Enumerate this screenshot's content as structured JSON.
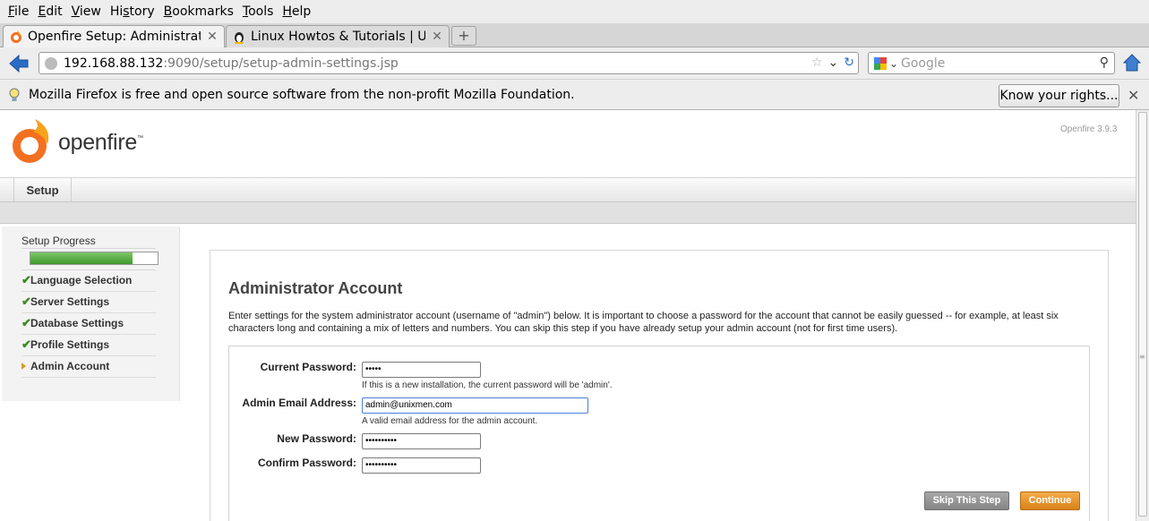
{
  "menubar": {
    "items": [
      {
        "accel": "F",
        "rest": "ile"
      },
      {
        "accel": "E",
        "rest": "dit"
      },
      {
        "accel": "V",
        "rest": "iew"
      },
      {
        "accel": "",
        "pre": "Hi",
        "accel2": "s",
        "rest": "tory"
      },
      {
        "accel": "B",
        "rest": "ookmarks"
      },
      {
        "accel": "T",
        "rest": "ools"
      },
      {
        "accel": "H",
        "rest": "elp"
      }
    ]
  },
  "tabs": [
    {
      "title": "Openfire Setup: Administrat...",
      "active": true
    },
    {
      "title": "Linux Howtos & Tutorials | U...",
      "active": false
    }
  ],
  "navbar": {
    "url_host": "192.168.88.132",
    "url_rest": ":9090/setup/setup-admin-settings.jsp",
    "search_placeholder": "Google"
  },
  "notification": {
    "message": "Mozilla Firefox is free and open source software from the non-profit Mozilla Foundation.",
    "button_label": "Know your rights..."
  },
  "page": {
    "logo_text": "openfire",
    "logo_tm": "™",
    "version": "Openfire 3.9.3",
    "nav_tab": "Setup",
    "sidebar": {
      "progress_label": "Setup Progress",
      "progress_fraction": 0.8,
      "steps": [
        {
          "label": "Language Selection",
          "done": true
        },
        {
          "label": "Server Settings",
          "done": true
        },
        {
          "label": "Database Settings",
          "done": true
        },
        {
          "label": "Profile Settings",
          "done": true
        },
        {
          "label": "Admin Account",
          "done": false
        }
      ]
    },
    "title": "Administrator Account",
    "intro": "Enter settings for the system administrator account (username of \"admin\") below. It is important to choose a password for the account that cannot be easily guessed -- for example, at least six characters long and containing a mix of letters and numbers. You can skip this step if you have already setup your admin account (not for first time users).",
    "form": {
      "current_password_label": "Current Password:",
      "current_password_value": "•••••",
      "current_password_hint": "If this is a new installation, the current password will be 'admin'.",
      "email_label": "Admin Email Address:",
      "email_value": "admin@unixmen.com",
      "email_hint": "A valid email address for the admin account.",
      "new_password_label": "New Password:",
      "new_password_value": "••••••••••",
      "confirm_password_label": "Confirm Password:",
      "confirm_password_value": "••••••••••",
      "skip_button": "Skip This Step",
      "continue_button": "Continue"
    }
  },
  "colors": {
    "progress_green": "#4fae3a",
    "check_green": "#3d8a1f",
    "continue_orange": "#e8951f",
    "logo_orange": "#f37021"
  }
}
